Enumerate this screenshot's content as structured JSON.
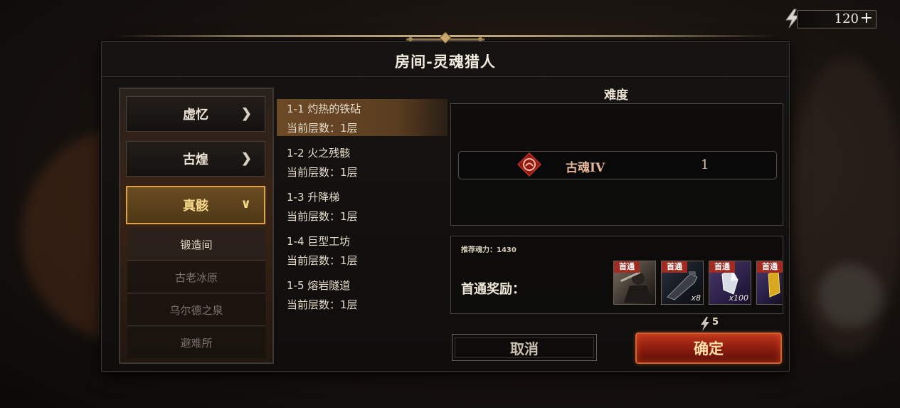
{
  "hud": {
    "energy_value": "120",
    "plus_label": "+"
  },
  "dialog": {
    "title": "房间-灵魂猎人",
    "chapters": [
      {
        "label": "虚忆",
        "chevron": "chevron-right-icon",
        "expanded": false
      },
      {
        "label": "古煌",
        "chevron": "chevron-right-icon",
        "expanded": false
      },
      {
        "label": "真骸",
        "chevron": "chevron-down-icon",
        "expanded": true
      }
    ],
    "sub_items": [
      {
        "label": "锻造间",
        "current": true
      },
      {
        "label": "古老冰原",
        "current": false
      },
      {
        "label": "乌尔德之泉",
        "current": false
      },
      {
        "label": "避难所",
        "current": false
      }
    ],
    "levels": [
      {
        "name": "1-1 灼热的铁砧",
        "floor": "当前层数：1层",
        "active": true
      },
      {
        "name": "1-2 火之残骸",
        "floor": "当前层数：1层",
        "active": false
      },
      {
        "name": "1-3 升降梯",
        "floor": "当前层数：1层",
        "active": false
      },
      {
        "name": "1-4 巨型工坊",
        "floor": "当前层数：1层",
        "active": false
      },
      {
        "name": "1-5 熔岩隧道",
        "floor": "当前层数：1层",
        "active": false
      }
    ],
    "difficulty": {
      "label": "难度",
      "name": "古魂IV",
      "value": "1"
    },
    "rewards": {
      "recommend": "推荐魂力：1430",
      "label": "首通奖励：",
      "items": [
        {
          "tag": "首通",
          "qty": "",
          "icon": "character-portrait-icon"
        },
        {
          "tag": "首通",
          "qty": "x8",
          "icon": "dark-weapon-icon"
        },
        {
          "tag": "首通",
          "qty": "x100",
          "icon": "crystal-shard-icon"
        },
        {
          "tag": "首通",
          "qty": "",
          "icon": "gold-item-icon"
        }
      ]
    },
    "cost": "5",
    "cancel_label": "取消",
    "confirm_label": "确定"
  },
  "colors": {
    "accent_gold": "#e0a23a",
    "confirm_red": "#8e1d10",
    "reward_tag_red": "#a12a22"
  }
}
